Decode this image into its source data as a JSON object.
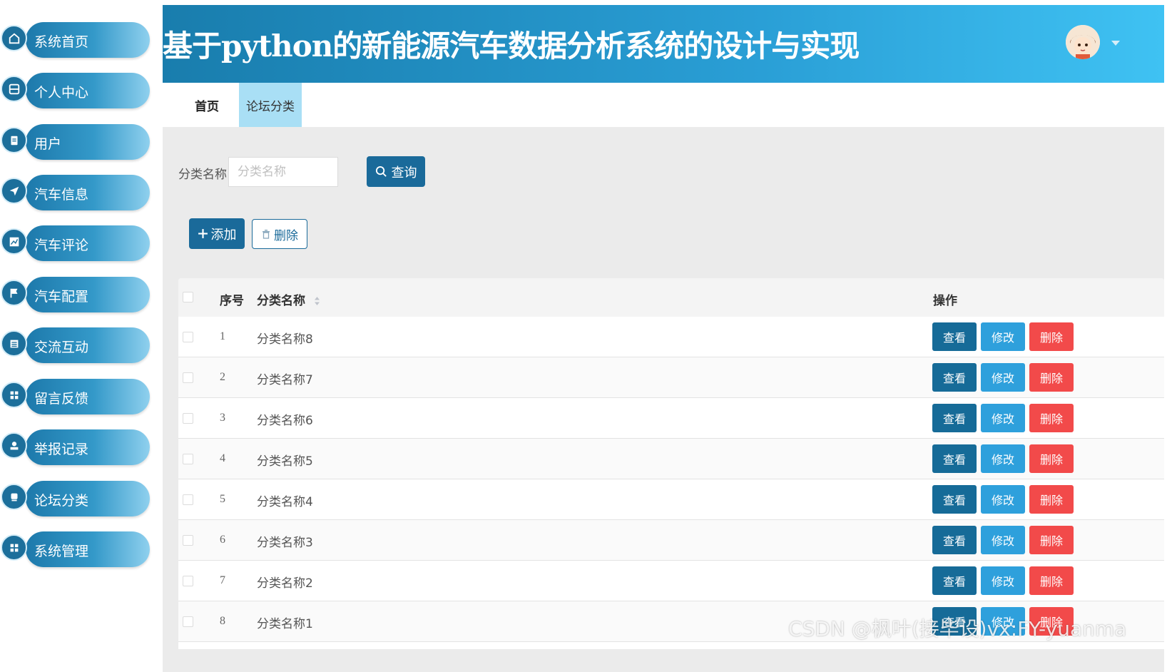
{
  "sidebar": {
    "items": [
      {
        "label": "系统首页",
        "icon": "home-icon"
      },
      {
        "label": "个人中心",
        "icon": "profile-icon"
      },
      {
        "label": "用户",
        "icon": "clipboard-icon"
      },
      {
        "label": "汽车信息",
        "icon": "send-icon"
      },
      {
        "label": "汽车评论",
        "icon": "chart-icon"
      },
      {
        "label": "汽车配置",
        "icon": "flag-icon"
      },
      {
        "label": "交流互动",
        "icon": "list-icon"
      },
      {
        "label": "留言反馈",
        "icon": "grid-icon"
      },
      {
        "label": "举报记录",
        "icon": "stamp-icon"
      },
      {
        "label": "论坛分类",
        "icon": "cup-icon"
      },
      {
        "label": "系统管理",
        "icon": "grid-icon"
      }
    ]
  },
  "header": {
    "title": "基于python的新能源汽车数据分析系统的设计与实现"
  },
  "tabs": {
    "home": "首页",
    "active": "论坛分类"
  },
  "search": {
    "label": "分类名称",
    "placeholder": "分类名称",
    "query_label": "查询"
  },
  "actions": {
    "add_label": "添加",
    "delete_label": "删除"
  },
  "table": {
    "headers": {
      "seq": "序号",
      "name": "分类名称",
      "op": "操作"
    },
    "rows": [
      {
        "seq": "1",
        "name": "分类名称8"
      },
      {
        "seq": "2",
        "name": "分类名称7"
      },
      {
        "seq": "3",
        "name": "分类名称6"
      },
      {
        "seq": "4",
        "name": "分类名称5"
      },
      {
        "seq": "5",
        "name": "分类名称4"
      },
      {
        "seq": "6",
        "name": "分类名称3"
      },
      {
        "seq": "7",
        "name": "分类名称2"
      },
      {
        "seq": "8",
        "name": "分类名称1"
      }
    ],
    "row_actions": {
      "view": "查看",
      "edit": "修改",
      "remove": "删除"
    }
  },
  "watermark": "CSDN @枫叶(接毕设)vx:FY-yuanma",
  "colors": {
    "primary": "#1a6a9a",
    "edit": "#2ea0dc",
    "danger": "#f24a4a",
    "header_start": "#197dad",
    "header_end": "#3fc2f3"
  }
}
